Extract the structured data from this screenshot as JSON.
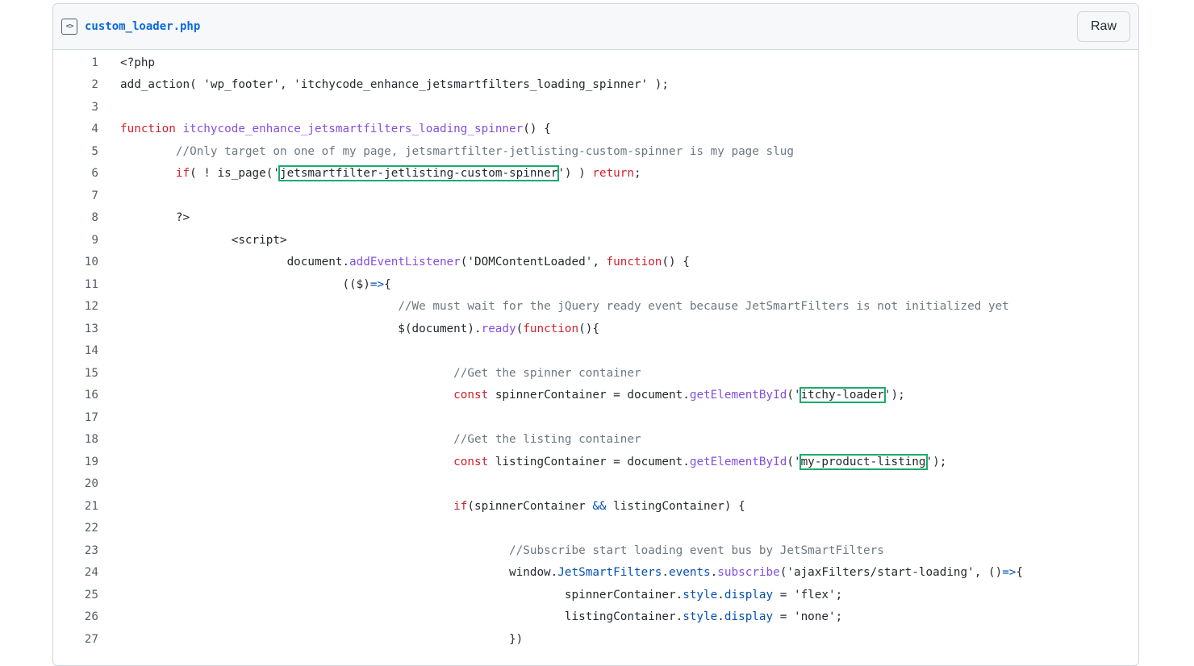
{
  "file": {
    "name": "custom_loader.php",
    "icon": "code-file-icon",
    "raw_label": "Raw"
  },
  "code_lines": [
    {
      "n": "1",
      "segs": [
        {
          "t": "<?php",
          "c": ""
        }
      ]
    },
    {
      "n": "2",
      "segs": [
        {
          "t": "add_action( 'wp_footer', 'itchycode_enhance_jetsmartfilters_loading_spinner' );",
          "c": ""
        }
      ]
    },
    {
      "n": "3",
      "segs": []
    },
    {
      "n": "4",
      "segs": [
        {
          "t": "function",
          "c": "kw"
        },
        {
          "t": " ",
          "c": ""
        },
        {
          "t": "itchycode_enhance_jetsmartfilters_loading_spinner",
          "c": "fn"
        },
        {
          "t": "() {",
          "c": ""
        }
      ]
    },
    {
      "n": "5",
      "segs": [
        {
          "t": "        ",
          "c": ""
        },
        {
          "t": "//Only target on one of my page, jetsmartfilter-jetlisting-custom-spinner is my page slug",
          "c": "cm"
        }
      ]
    },
    {
      "n": "6",
      "segs": [
        {
          "t": "        ",
          "c": ""
        },
        {
          "t": "if",
          "c": "kw"
        },
        {
          "t": "( ! is_page('",
          "c": ""
        },
        {
          "t": "jetsmartfilter-jetlisting-custom-spinner",
          "c": "hl"
        },
        {
          "t": "') ) ",
          "c": ""
        },
        {
          "t": "return",
          "c": "kw"
        },
        {
          "t": ";",
          "c": ""
        }
      ]
    },
    {
      "n": "7",
      "segs": []
    },
    {
      "n": "8",
      "segs": [
        {
          "t": "        ?>",
          "c": ""
        }
      ]
    },
    {
      "n": "9",
      "segs": [
        {
          "t": "                <script>",
          "c": ""
        }
      ]
    },
    {
      "n": "10",
      "segs": [
        {
          "t": "                        document.",
          "c": ""
        },
        {
          "t": "addEventListener",
          "c": "fn"
        },
        {
          "t": "('DOMContentLoaded', ",
          "c": ""
        },
        {
          "t": "function",
          "c": "kw"
        },
        {
          "t": "() {",
          "c": ""
        }
      ]
    },
    {
      "n": "11",
      "segs": [
        {
          "t": "                                (($)",
          "c": ""
        },
        {
          "t": "=>",
          "c": "op"
        },
        {
          "t": "{",
          "c": ""
        }
      ]
    },
    {
      "n": "12",
      "segs": [
        {
          "t": "                                        ",
          "c": ""
        },
        {
          "t": "//We must wait for the jQuery ready event because JetSmartFilters is not initialized yet",
          "c": "cm"
        }
      ]
    },
    {
      "n": "13",
      "segs": [
        {
          "t": "                                        $(document).",
          "c": ""
        },
        {
          "t": "ready",
          "c": "fn"
        },
        {
          "t": "(",
          "c": ""
        },
        {
          "t": "function",
          "c": "kw"
        },
        {
          "t": "(){",
          "c": ""
        }
      ]
    },
    {
      "n": "14",
      "segs": []
    },
    {
      "n": "15",
      "segs": [
        {
          "t": "                                                ",
          "c": ""
        },
        {
          "t": "//Get the spinner container",
          "c": "cm"
        }
      ]
    },
    {
      "n": "16",
      "segs": [
        {
          "t": "                                                ",
          "c": ""
        },
        {
          "t": "const",
          "c": "kw"
        },
        {
          "t": " spinnerContainer = document.",
          "c": ""
        },
        {
          "t": "getElementById",
          "c": "fn"
        },
        {
          "t": "('",
          "c": ""
        },
        {
          "t": "itchy-loader",
          "c": "hl"
        },
        {
          "t": "');",
          "c": ""
        }
      ]
    },
    {
      "n": "17",
      "segs": []
    },
    {
      "n": "18",
      "segs": [
        {
          "t": "                                                ",
          "c": ""
        },
        {
          "t": "//Get the listing container",
          "c": "cm"
        }
      ]
    },
    {
      "n": "19",
      "segs": [
        {
          "t": "                                                ",
          "c": ""
        },
        {
          "t": "const",
          "c": "kw"
        },
        {
          "t": " listingContainer = document.",
          "c": ""
        },
        {
          "t": "getElementById",
          "c": "fn"
        },
        {
          "t": "('",
          "c": ""
        },
        {
          "t": "my-product-listing",
          "c": "hl"
        },
        {
          "t": "');",
          "c": ""
        }
      ]
    },
    {
      "n": "20",
      "segs": []
    },
    {
      "n": "21",
      "segs": [
        {
          "t": "                                                ",
          "c": ""
        },
        {
          "t": "if",
          "c": "kw"
        },
        {
          "t": "(spinnerContainer ",
          "c": ""
        },
        {
          "t": "&&",
          "c": "op"
        },
        {
          "t": " listingContainer) {",
          "c": ""
        }
      ]
    },
    {
      "n": "22",
      "segs": []
    },
    {
      "n": "23",
      "segs": [
        {
          "t": "                                                        ",
          "c": ""
        },
        {
          "t": "//Subscribe start loading event bus by JetSmartFilters",
          "c": "cm"
        }
      ]
    },
    {
      "n": "24",
      "segs": [
        {
          "t": "                                                        window.",
          "c": ""
        },
        {
          "t": "JetSmartFilters",
          "c": "op"
        },
        {
          "t": ".",
          "c": ""
        },
        {
          "t": "events",
          "c": "op"
        },
        {
          "t": ".",
          "c": ""
        },
        {
          "t": "subscribe",
          "c": "fn"
        },
        {
          "t": "('ajaxFilters/start-loading', ()",
          "c": ""
        },
        {
          "t": "=>",
          "c": "op"
        },
        {
          "t": "{",
          "c": ""
        }
      ]
    },
    {
      "n": "25",
      "segs": [
        {
          "t": "                                                                spinnerContainer.",
          "c": ""
        },
        {
          "t": "style",
          "c": "op"
        },
        {
          "t": ".",
          "c": ""
        },
        {
          "t": "display",
          "c": "op"
        },
        {
          "t": " = 'flex';",
          "c": ""
        }
      ]
    },
    {
      "n": "26",
      "segs": [
        {
          "t": "                                                                listingContainer.",
          "c": ""
        },
        {
          "t": "style",
          "c": "op"
        },
        {
          "t": ".",
          "c": ""
        },
        {
          "t": "display",
          "c": "op"
        },
        {
          "t": " = 'none';",
          "c": ""
        }
      ]
    },
    {
      "n": "27",
      "segs": [
        {
          "t": "                                                        })",
          "c": ""
        }
      ]
    }
  ]
}
